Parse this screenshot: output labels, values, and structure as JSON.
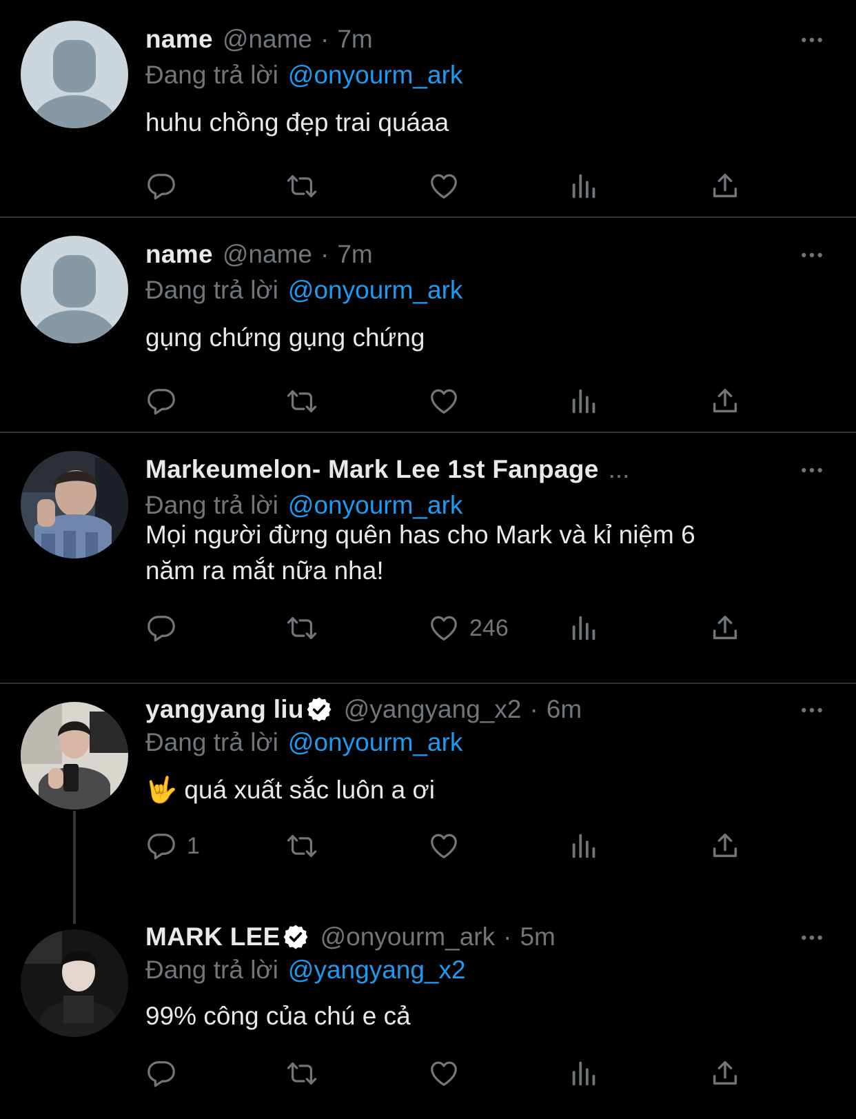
{
  "icons": {
    "reply": "speech-bubble-icon",
    "retweet": "retweet-arrows-icon",
    "like": "heart-icon",
    "views": "bar-chart-icon",
    "share": "share-upload-icon",
    "more": "ellipsis-icon",
    "verified": "verified-badge-icon"
  },
  "colors": {
    "background": "#000000",
    "text": "#e7e9ea",
    "muted": "#71767b",
    "accent": "#1d9bf0",
    "divider": "#2f3336"
  },
  "tweets": [
    {
      "name": "name",
      "handle": "@name",
      "separator": "·",
      "time": "7m",
      "replying_label": "Đang trả lời",
      "replying_to": "@onyourm_ark",
      "text": "huhu chồng đẹp trai quáaa",
      "like_count": "",
      "reply_count": ""
    },
    {
      "name": "name",
      "handle": "@name",
      "separator": "·",
      "time": "7m",
      "replying_label": "Đang trả lời",
      "replying_to": "@onyourm_ark",
      "text": "gụng chứng gụng chứng",
      "like_count": "",
      "reply_count": ""
    },
    {
      "name": "Markeumelon- Mark Lee 1st Fanpage",
      "truncation": "...",
      "replying_label": "Đang trả lời",
      "replying_to": "@onyourm_ark",
      "text_line1": "Mọi người đừng quên has cho Mark và kỉ niệm 6",
      "text_line2": "năm ra mắt nữa nha!",
      "like_count": "246",
      "reply_count": ""
    },
    {
      "name": "yangyang liu",
      "verified": true,
      "handle": "@yangyang_x2",
      "separator": "·",
      "time": "6m",
      "replying_label": "Đang trả lời",
      "replying_to": "@onyourm_ark",
      "emoji": "🤟",
      "text": "quá xuất sắc luôn a ơi",
      "like_count": "",
      "reply_count": "1"
    },
    {
      "name": "MARK LEE",
      "verified": true,
      "handle": "@onyourm_ark",
      "separator": "·",
      "time": "5m",
      "replying_label": "Đang trả lời",
      "replying_to": "@yangyang_x2",
      "text": "99% công của chú e cả",
      "like_count": "",
      "reply_count": ""
    }
  ]
}
